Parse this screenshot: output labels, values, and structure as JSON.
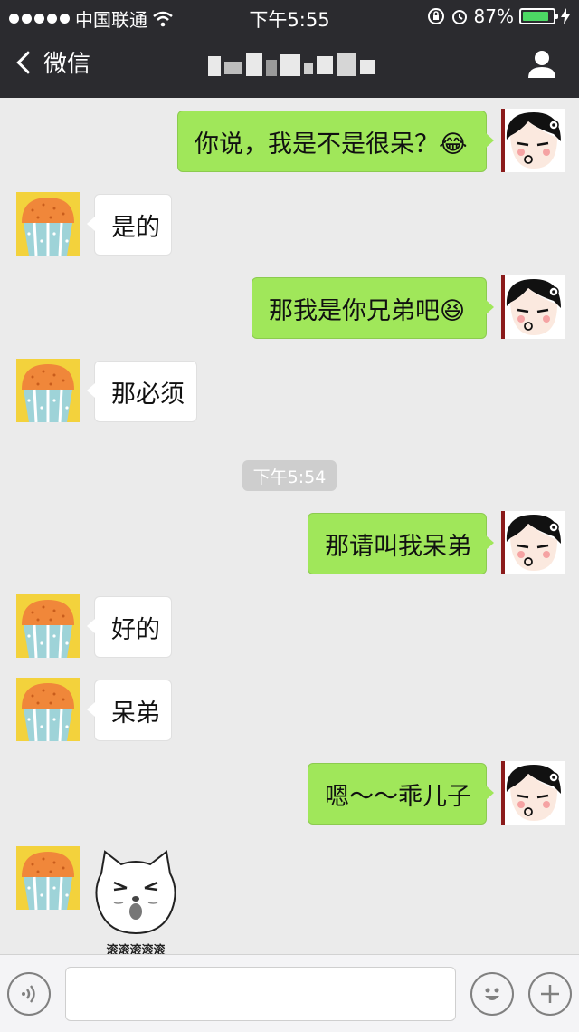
{
  "status_bar": {
    "carrier": "中国联通",
    "time": "下午5:55",
    "battery_percent": "87%",
    "battery_level": 0.87
  },
  "nav": {
    "back_label": "微信",
    "title_icon": "pixelated-contact-name",
    "profile_icon": "person-icon"
  },
  "messages": [
    {
      "side": "out",
      "text": "你说，我是不是很呆？😂"
    },
    {
      "side": "in",
      "text": "是的"
    },
    {
      "side": "out",
      "text": "那我是你兄弟吧😆"
    },
    {
      "side": "in",
      "text": "那必须"
    },
    {
      "side": "out",
      "text": "那请叫我呆弟"
    },
    {
      "side": "in",
      "text": "好的"
    },
    {
      "side": "in",
      "text": "呆弟"
    },
    {
      "side": "out",
      "text": "嗯～～乖儿子"
    },
    {
      "side": "in",
      "sticker": "cat-face-sticker",
      "sticker_caption": "滚滚滚滚滚"
    }
  ],
  "timestamp": "下午5:54",
  "input_bar": {
    "voice_icon": "voice-icon",
    "emoji_icon": "emoji-icon",
    "plus_icon": "plus-icon",
    "placeholder": ""
  },
  "colors": {
    "topbar": "#2b2b2f",
    "bubble_out": "#a0e75a",
    "bubble_in": "#ffffff",
    "background": "#ebebeb"
  }
}
